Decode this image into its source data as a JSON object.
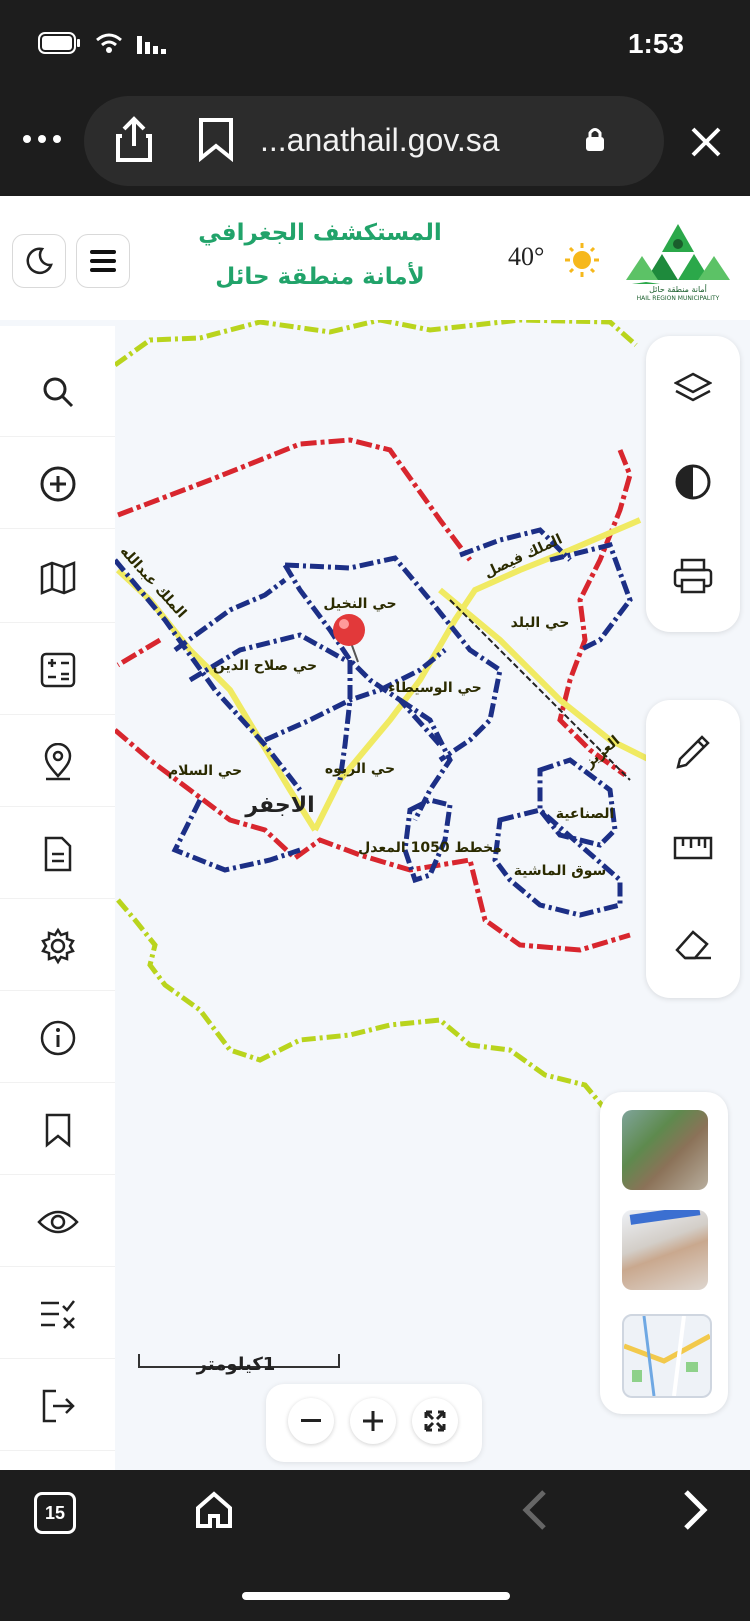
{
  "status_bar": {
    "time": "1:53"
  },
  "browser": {
    "url": "...anathail.gov.sa",
    "tab_count": "15"
  },
  "header": {
    "title_line1": "المستكشف الجغرافي",
    "title_line2": "لأمانة منطقة حائل",
    "temperature": "40°",
    "logo_caption": "HAIL REGION MUNICIPALITY",
    "logo_arabic": "أمانة منطقة حائل"
  },
  "left_toolbar": {
    "items": [
      "search-icon",
      "add-circle-icon",
      "map-icon",
      "calculator-icon",
      "location-pin-icon",
      "document-icon",
      "settings-icon",
      "info-icon",
      "bookmark-icon",
      "eye-icon",
      "checklist-icon",
      "logout-icon"
    ]
  },
  "right_panel_top": {
    "items": [
      "layers-icon",
      "contrast-icon",
      "printer-icon"
    ]
  },
  "right_panel_tools": {
    "items": [
      "pencil-icon",
      "ruler-icon",
      "eraser-icon"
    ]
  },
  "map": {
    "labels": {
      "nakheel": "حي النخيل",
      "salahaldin": "حي صلاح الدين",
      "balad": "حي البلد",
      "wusaita": "حي الوسيطاء",
      "salam": "حي السلام",
      "rabwa": "حي الربوه",
      "ajfar": "الاجفر",
      "sinaiya": "الصناعية",
      "mukhattat": "مخطط 1050 المعدل",
      "souq": "سوق الماشية",
      "king_faisal": "الملك فيصل",
      "king_abdullah": "الملك عبدالله",
      "aziz": "العزيز"
    },
    "scale_label": "1كيلومتر"
  },
  "colors": {
    "accent_green": "#21a36a",
    "boundary_red": "#d8262e",
    "district_blue": "#1c2f86",
    "road_yellow": "#f0ea62",
    "region_green": "#c8e21d"
  }
}
